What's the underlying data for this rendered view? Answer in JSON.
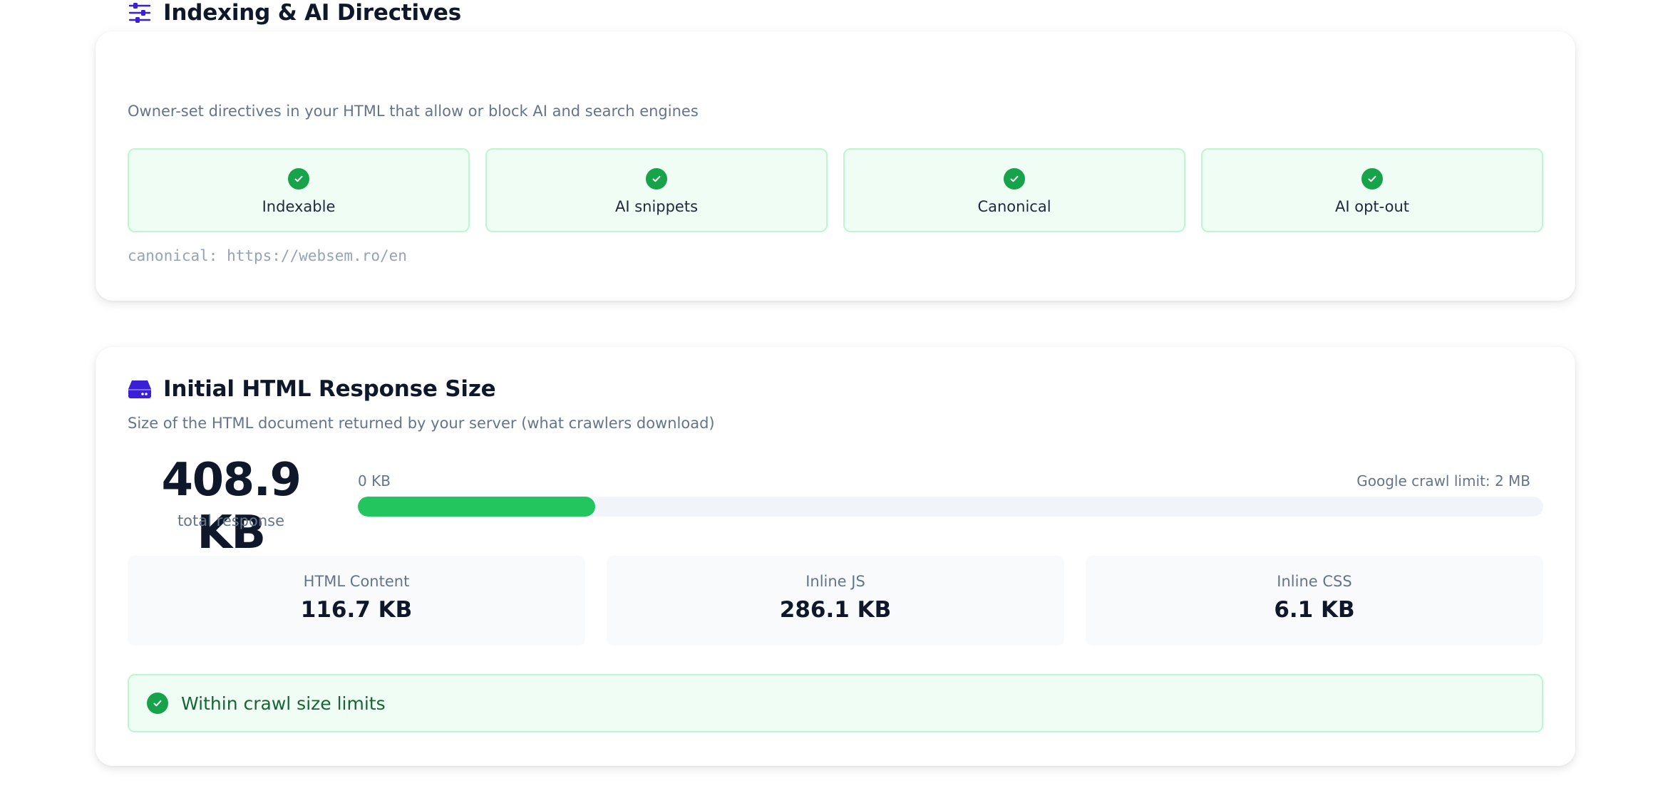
{
  "indexing": {
    "title": "Indexing & AI Directives",
    "description": "Owner-set directives in your HTML that allow or block AI and search engines",
    "icon": "sliders-icon",
    "tiles": [
      {
        "label": "Indexable",
        "status": "pass",
        "icon": "check-circle-icon"
      },
      {
        "label": "AI snippets",
        "status": "pass",
        "icon": "check-circle-icon"
      },
      {
        "label": "Canonical",
        "status": "pass",
        "icon": "check-circle-icon"
      },
      {
        "label": "AI opt-out",
        "status": "pass",
        "icon": "check-circle-icon"
      }
    ],
    "canonical_text": "canonical: https://websem.ro/en"
  },
  "size": {
    "title": "Initial HTML Response Size",
    "description": "Size of the HTML document returned by your server (what crawlers download)",
    "icon": "hard-drive-icon",
    "total_value": "408.9 KB",
    "total_label": "total response",
    "bar_min_label": "0 KB",
    "bar_max_label": "Google crawl limit: 2 MB",
    "bar_fill_fraction": 0.2,
    "breakdown": [
      {
        "label": "HTML Content",
        "value": "116.7 KB"
      },
      {
        "label": "Inline JS",
        "value": "286.1 KB"
      },
      {
        "label": "Inline CSS",
        "value": "6.1 KB"
      }
    ],
    "status_text": "Within crawl size limits",
    "status_icon": "check-circle-icon"
  },
  "colors": {
    "accent": "#3b1fd6",
    "success": "#16a34a",
    "bar_fill": "#22c55e",
    "success_bg": "#f0fdf4",
    "success_border": "#bbf7d0"
  }
}
